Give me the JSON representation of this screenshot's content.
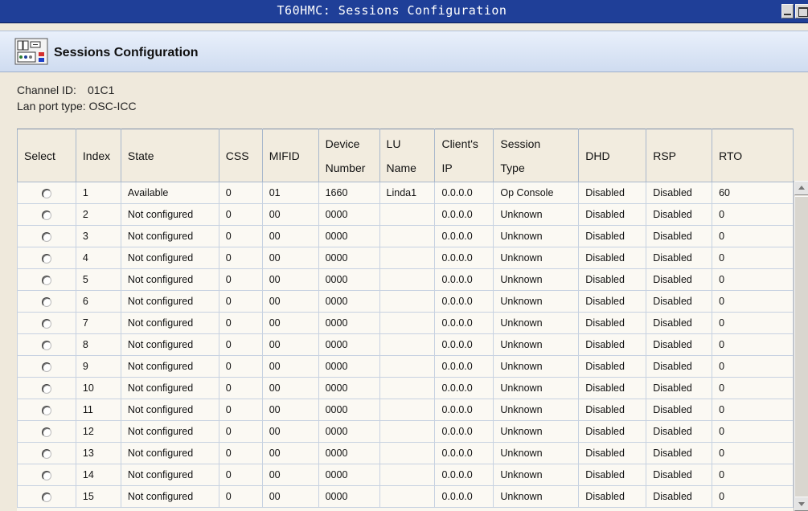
{
  "window": {
    "title": "T60HMC: Sessions Configuration"
  },
  "header": {
    "title": "Sessions Configuration",
    "icon": "configuration-panel-icon"
  },
  "info": {
    "channel_label": "Channel ID:",
    "channel_value": "01C1",
    "lan_label": "Lan port type:",
    "lan_value": "OSC-ICC"
  },
  "table": {
    "columns": [
      {
        "l1": "Select",
        "l2": ""
      },
      {
        "l1": "Index",
        "l2": ""
      },
      {
        "l1": "State",
        "l2": ""
      },
      {
        "l1": "CSS",
        "l2": ""
      },
      {
        "l1": "MIFID",
        "l2": ""
      },
      {
        "l1": "Device",
        "l2": "Number"
      },
      {
        "l1": "LU",
        "l2": "Name"
      },
      {
        "l1": "Client's",
        "l2": "IP"
      },
      {
        "l1": "Session",
        "l2": "Type"
      },
      {
        "l1": "DHD",
        "l2": ""
      },
      {
        "l1": "RSP",
        "l2": ""
      },
      {
        "l1": "RTO",
        "l2": ""
      }
    ],
    "rows": [
      [
        "1",
        "Available",
        "0",
        "01",
        "1660",
        "Linda1",
        "0.0.0.0",
        "Op Console",
        "Disabled",
        "Disabled",
        "60"
      ],
      [
        "2",
        "Not configured",
        "0",
        "00",
        "0000",
        "",
        "0.0.0.0",
        "Unknown",
        "Disabled",
        "Disabled",
        "0"
      ],
      [
        "3",
        "Not configured",
        "0",
        "00",
        "0000",
        "",
        "0.0.0.0",
        "Unknown",
        "Disabled",
        "Disabled",
        "0"
      ],
      [
        "4",
        "Not configured",
        "0",
        "00",
        "0000",
        "",
        "0.0.0.0",
        "Unknown",
        "Disabled",
        "Disabled",
        "0"
      ],
      [
        "5",
        "Not configured",
        "0",
        "00",
        "0000",
        "",
        "0.0.0.0",
        "Unknown",
        "Disabled",
        "Disabled",
        "0"
      ],
      [
        "6",
        "Not configured",
        "0",
        "00",
        "0000",
        "",
        "0.0.0.0",
        "Unknown",
        "Disabled",
        "Disabled",
        "0"
      ],
      [
        "7",
        "Not configured",
        "0",
        "00",
        "0000",
        "",
        "0.0.0.0",
        "Unknown",
        "Disabled",
        "Disabled",
        "0"
      ],
      [
        "8",
        "Not configured",
        "0",
        "00",
        "0000",
        "",
        "0.0.0.0",
        "Unknown",
        "Disabled",
        "Disabled",
        "0"
      ],
      [
        "9",
        "Not configured",
        "0",
        "00",
        "0000",
        "",
        "0.0.0.0",
        "Unknown",
        "Disabled",
        "Disabled",
        "0"
      ],
      [
        "10",
        "Not configured",
        "0",
        "00",
        "0000",
        "",
        "0.0.0.0",
        "Unknown",
        "Disabled",
        "Disabled",
        "0"
      ],
      [
        "11",
        "Not configured",
        "0",
        "00",
        "0000",
        "",
        "0.0.0.0",
        "Unknown",
        "Disabled",
        "Disabled",
        "0"
      ],
      [
        "12",
        "Not configured",
        "0",
        "00",
        "0000",
        "",
        "0.0.0.0",
        "Unknown",
        "Disabled",
        "Disabled",
        "0"
      ],
      [
        "13",
        "Not configured",
        "0",
        "00",
        "0000",
        "",
        "0.0.0.0",
        "Unknown",
        "Disabled",
        "Disabled",
        "0"
      ],
      [
        "14",
        "Not configured",
        "0",
        "00",
        "0000",
        "",
        "0.0.0.0",
        "Unknown",
        "Disabled",
        "Disabled",
        "0"
      ],
      [
        "15",
        "Not configured",
        "0",
        "00",
        "0000",
        "",
        "0.0.0.0",
        "Unknown",
        "Disabled",
        "Disabled",
        "0"
      ]
    ]
  },
  "colors": {
    "titlebar": "#1f3f98",
    "header_band": "#d7e2f3",
    "page_background": "#efe9dc",
    "grid_line": "#a9b8cc"
  }
}
